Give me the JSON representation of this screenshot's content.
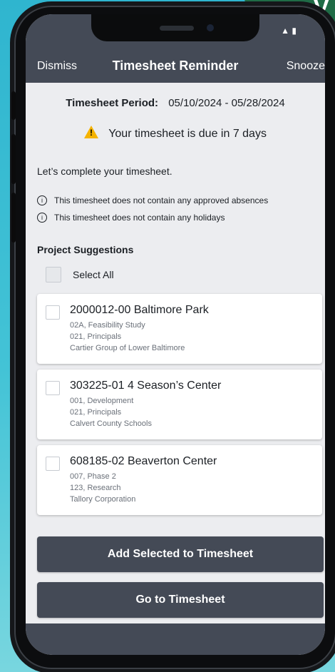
{
  "corner_letter": "V",
  "status": {
    "icons_text": "▲ ▮"
  },
  "header": {
    "dismiss_label": "Dismiss",
    "title": "Timesheet Reminder",
    "snooze_label": "Snooze"
  },
  "period": {
    "label": "Timesheet Period:",
    "value": "05/10/2024 - 05/28/2024"
  },
  "due_message": "Your timesheet is due in 7 days",
  "complete_message": "Let’s complete your timesheet.",
  "notices": [
    {
      "text": "This timesheet does not contain any approved absences",
      "icon": "info-icon"
    },
    {
      "text": "This timesheet does not contain any holidays",
      "icon": "info-icon"
    }
  ],
  "suggestions_heading": "Project Suggestions",
  "select_all_label": "Select All",
  "projects": [
    {
      "title": "2000012-00 Baltimore Park",
      "line1": "02A, Feasibility Study",
      "line2": "021, Principals",
      "line3": "Cartier Group of Lower Baltimore",
      "checked": false
    },
    {
      "title": "303225-01 4 Season’s Center",
      "line1": "001, Development",
      "line2": "021, Principals",
      "line3": "Calvert County Schools",
      "checked": false
    },
    {
      "title": "608185-02 Beaverton Center",
      "line1": "007, Phase 2",
      "line2": "123, Research",
      "line3": "Tallory Corporation",
      "checked": false
    }
  ],
  "buttons": {
    "add_selected": "Add Selected to Timesheet",
    "go_to": "Go to Timesheet"
  },
  "colors": {
    "header_bg": "#444a56",
    "screen_bg": "#ecedf0",
    "warning": "#f5b300",
    "badge": "#1f6b46"
  }
}
